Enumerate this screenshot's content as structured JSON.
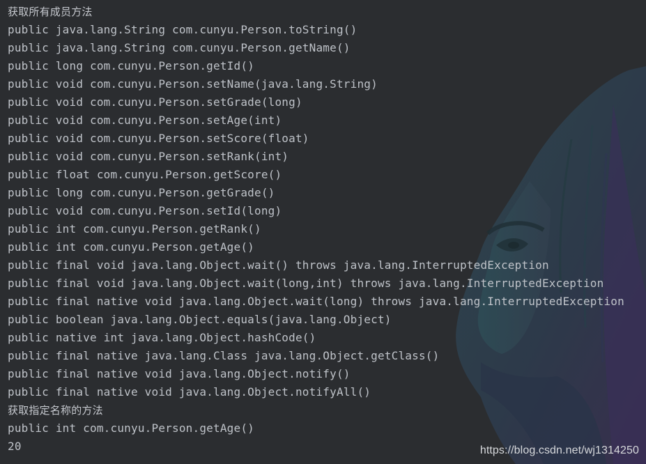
{
  "console": {
    "lines": [
      {
        "text": "获取所有成员方法",
        "kind": "heading"
      },
      {
        "text": "public java.lang.String com.cunyu.Person.toString()",
        "kind": "output"
      },
      {
        "text": "public java.lang.String com.cunyu.Person.getName()",
        "kind": "output"
      },
      {
        "text": "public long com.cunyu.Person.getId()",
        "kind": "output"
      },
      {
        "text": "public void com.cunyu.Person.setName(java.lang.String)",
        "kind": "output"
      },
      {
        "text": "public void com.cunyu.Person.setGrade(long)",
        "kind": "output"
      },
      {
        "text": "public void com.cunyu.Person.setAge(int)",
        "kind": "output"
      },
      {
        "text": "public void com.cunyu.Person.setScore(float)",
        "kind": "output"
      },
      {
        "text": "public void com.cunyu.Person.setRank(int)",
        "kind": "output"
      },
      {
        "text": "public float com.cunyu.Person.getScore()",
        "kind": "output"
      },
      {
        "text": "public long com.cunyu.Person.getGrade()",
        "kind": "output"
      },
      {
        "text": "public void com.cunyu.Person.setId(long)",
        "kind": "output"
      },
      {
        "text": "public int com.cunyu.Person.getRank()",
        "kind": "output"
      },
      {
        "text": "public int com.cunyu.Person.getAge()",
        "kind": "output"
      },
      {
        "text": "public final void java.lang.Object.wait() throws java.lang.InterruptedException",
        "kind": "output"
      },
      {
        "text": "public final void java.lang.Object.wait(long,int) throws java.lang.InterruptedException",
        "kind": "output"
      },
      {
        "text": "public final native void java.lang.Object.wait(long) throws java.lang.InterruptedException",
        "kind": "output"
      },
      {
        "text": "public boolean java.lang.Object.equals(java.lang.Object)",
        "kind": "output"
      },
      {
        "text": "public native int java.lang.Object.hashCode()",
        "kind": "output"
      },
      {
        "text": "public final native java.lang.Class java.lang.Object.getClass()",
        "kind": "output"
      },
      {
        "text": "public final native void java.lang.Object.notify()",
        "kind": "output"
      },
      {
        "text": "public final native void java.lang.Object.notifyAll()",
        "kind": "output"
      },
      {
        "text": "获取指定名称的方法",
        "kind": "heading"
      },
      {
        "text": "public int com.cunyu.Person.getAge()",
        "kind": "output"
      },
      {
        "text": "20",
        "kind": "output"
      }
    ]
  },
  "watermark": "https://blog.csdn.net/wj1314250",
  "colors": {
    "background": "#2b2d30",
    "text": "#bfc3c9"
  }
}
